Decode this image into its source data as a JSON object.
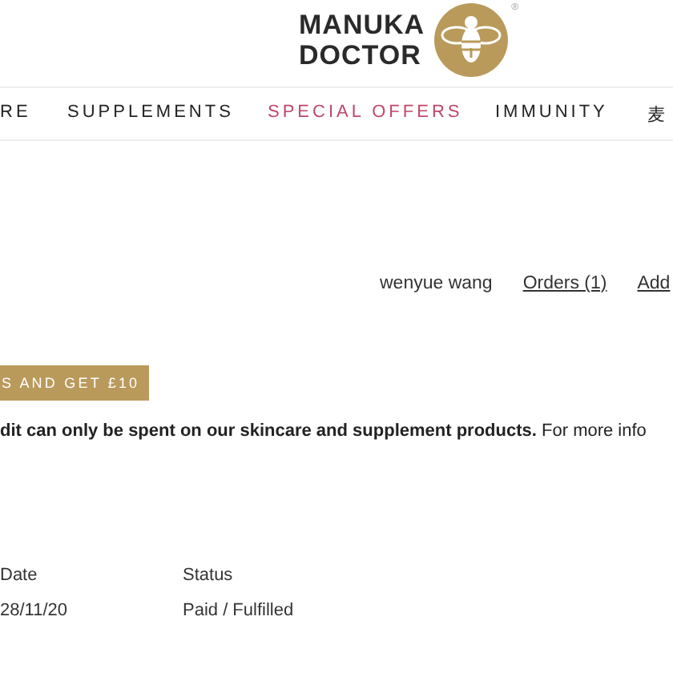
{
  "logo": {
    "line_1": "MANUKA",
    "line_2": "DOCTOR",
    "mark": "®"
  },
  "nav": [
    {
      "label": "RE",
      "selected": false
    },
    {
      "label": "SUPPLEMENTS",
      "selected": false
    },
    {
      "label": "SPECIAL OFFERS",
      "selected": true
    },
    {
      "label": "IMMUNITY",
      "selected": false
    },
    {
      "label": "麦",
      "selected": false
    }
  ],
  "account": {
    "name": "wenyue wang",
    "links": [
      "Orders (1)",
      "Add"
    ]
  },
  "referral_button": "S AND GET £10",
  "notice": "**dit can only be spent on our skincare and supplement products.** For more info",
  "orders": {
    "columns": [
      "Date",
      "Status"
    ],
    "rows": [
      [
        "28/11/20",
        "Paid / Fulfilled"
      ]
    ]
  }
}
